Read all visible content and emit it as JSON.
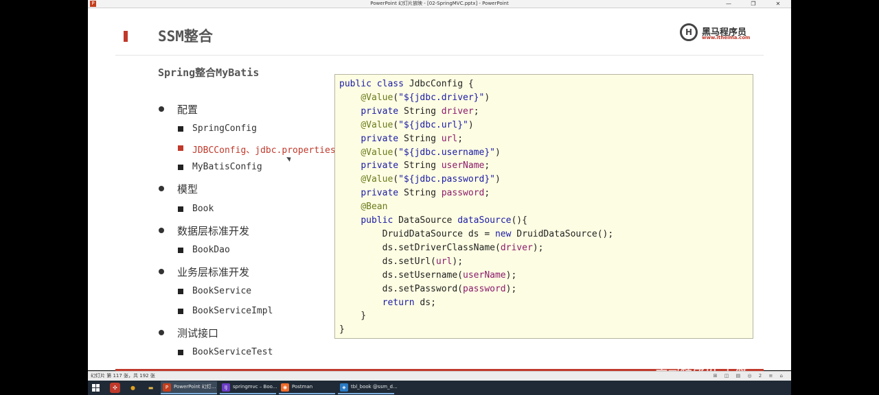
{
  "window": {
    "title": "PowerPoint 幻灯片放映 - [02-SpringMVC.pptx] - PowerPoint",
    "app_icon_glyph": "P",
    "controls": [
      "—",
      "❐",
      "✕"
    ]
  },
  "slide": {
    "title": "SSM整合",
    "subtitle": "Spring整合MyBatis",
    "logo": {
      "name": "黑马程序员",
      "url": "www.itheima.com",
      "glyph": "H"
    },
    "watermark": "黑马程序员 上海",
    "outline": [
      {
        "label": "配置",
        "children": [
          {
            "label": "SpringConfig",
            "highlight": false
          },
          {
            "label": "JDBCConfig、jdbc.properties",
            "highlight": true
          },
          {
            "label": "MyBatisConfig",
            "highlight": false
          }
        ]
      },
      {
        "label": "模型",
        "children": [
          {
            "label": "Book",
            "highlight": false
          }
        ]
      },
      {
        "label": "数据层标准开发",
        "children": [
          {
            "label": "BookDao",
            "highlight": false
          }
        ]
      },
      {
        "label": "业务层标准开发",
        "children": [
          {
            "label": "BookService",
            "highlight": false
          },
          {
            "label": "BookServiceImpl",
            "highlight": false
          }
        ]
      },
      {
        "label": "测试接口",
        "children": [
          {
            "label": "BookServiceTest",
            "highlight": false
          }
        ]
      }
    ],
    "code": [
      [
        [
          "kw",
          "public class "
        ],
        [
          "",
          "JdbcConfig {"
        ]
      ],
      [
        [
          "",
          "    "
        ],
        [
          "an",
          "@Value"
        ],
        [
          "",
          "("
        ],
        [
          "st",
          "\"${jdbc.driver}\""
        ],
        [
          "",
          ")"
        ]
      ],
      [
        [
          "",
          "    "
        ],
        [
          "kw",
          "private "
        ],
        [
          "",
          "String "
        ],
        [
          "vr",
          "driver"
        ],
        [
          "",
          ";"
        ]
      ],
      [
        [
          "",
          "    "
        ],
        [
          "an",
          "@Value"
        ],
        [
          "",
          "("
        ],
        [
          "st",
          "\"${jdbc.url}\""
        ],
        [
          "",
          ")"
        ]
      ],
      [
        [
          "",
          "    "
        ],
        [
          "kw",
          "private "
        ],
        [
          "",
          "String "
        ],
        [
          "vr",
          "url"
        ],
        [
          "",
          ";"
        ]
      ],
      [
        [
          "",
          "    "
        ],
        [
          "an",
          "@Value"
        ],
        [
          "",
          "("
        ],
        [
          "st",
          "\"${jdbc.username}\""
        ],
        [
          "",
          ")"
        ]
      ],
      [
        [
          "",
          "    "
        ],
        [
          "kw",
          "private "
        ],
        [
          "",
          "String "
        ],
        [
          "vr",
          "userName"
        ],
        [
          "",
          ";"
        ]
      ],
      [
        [
          "",
          "    "
        ],
        [
          "an",
          "@Value"
        ],
        [
          "",
          "("
        ],
        [
          "st",
          "\"${jdbc.password}\""
        ],
        [
          "",
          ")"
        ]
      ],
      [
        [
          "",
          "    "
        ],
        [
          "kw",
          "private "
        ],
        [
          "",
          "String "
        ],
        [
          "vr",
          "password"
        ],
        [
          "",
          ";"
        ]
      ],
      [
        [
          "",
          "    "
        ],
        [
          "an",
          "@Bean"
        ]
      ],
      [
        [
          "",
          "    "
        ],
        [
          "kw",
          "public "
        ],
        [
          "",
          "DataSource "
        ],
        [
          "mt",
          "dataSource"
        ],
        [
          "",
          "(){"
        ]
      ],
      [
        [
          "",
          "        DruidDataSource ds = "
        ],
        [
          "kw",
          "new "
        ],
        [
          "",
          "DruidDataSource();"
        ]
      ],
      [
        [
          "",
          "        ds.setDriverClassName("
        ],
        [
          "vr",
          "driver"
        ],
        [
          "",
          ");"
        ]
      ],
      [
        [
          "",
          "        ds.setUrl("
        ],
        [
          "vr",
          "url"
        ],
        [
          "",
          ");"
        ]
      ],
      [
        [
          "",
          "        ds.setUsername("
        ],
        [
          "vr",
          "userName"
        ],
        [
          "",
          ");"
        ]
      ],
      [
        [
          "",
          "        ds.setPassword("
        ],
        [
          "vr",
          "password"
        ],
        [
          "",
          ");"
        ]
      ],
      [
        [
          "",
          "        "
        ],
        [
          "kw",
          "return "
        ],
        [
          "",
          "ds;"
        ]
      ],
      [
        [
          "",
          "    }"
        ]
      ],
      [
        [
          "",
          "}"
        ]
      ]
    ]
  },
  "statusbar": {
    "text": "幻灯片 第 117 张，共 192 张",
    "controls": "⊞ ◫ ▤ ◎ 2 ≡ ⌂"
  },
  "taskbar": {
    "tray_icons": [
      {
        "name": "chrome-icon",
        "glyph": "●",
        "color": "#e0a020"
      },
      {
        "name": "folder-icon",
        "glyph": "▬",
        "color": "#e8b84a"
      }
    ],
    "items": [
      {
        "name": "taskbar-powerpoint",
        "label": "PowerPoint 幻灯...",
        "glyph": "P",
        "color": "#c43e1c",
        "active": true
      },
      {
        "name": "taskbar-springmvc",
        "label": "springmvc – Boo...",
        "glyph": "IJ",
        "color": "#6a3cc4",
        "active": false
      },
      {
        "name": "taskbar-postman",
        "label": "Postman",
        "glyph": "◉",
        "color": "#ef6c2a",
        "active": false
      },
      {
        "name": "taskbar-database",
        "label": "tbl_book @ssm_d...",
        "glyph": "◈",
        "color": "#2a7ac4",
        "active": false
      }
    ]
  }
}
